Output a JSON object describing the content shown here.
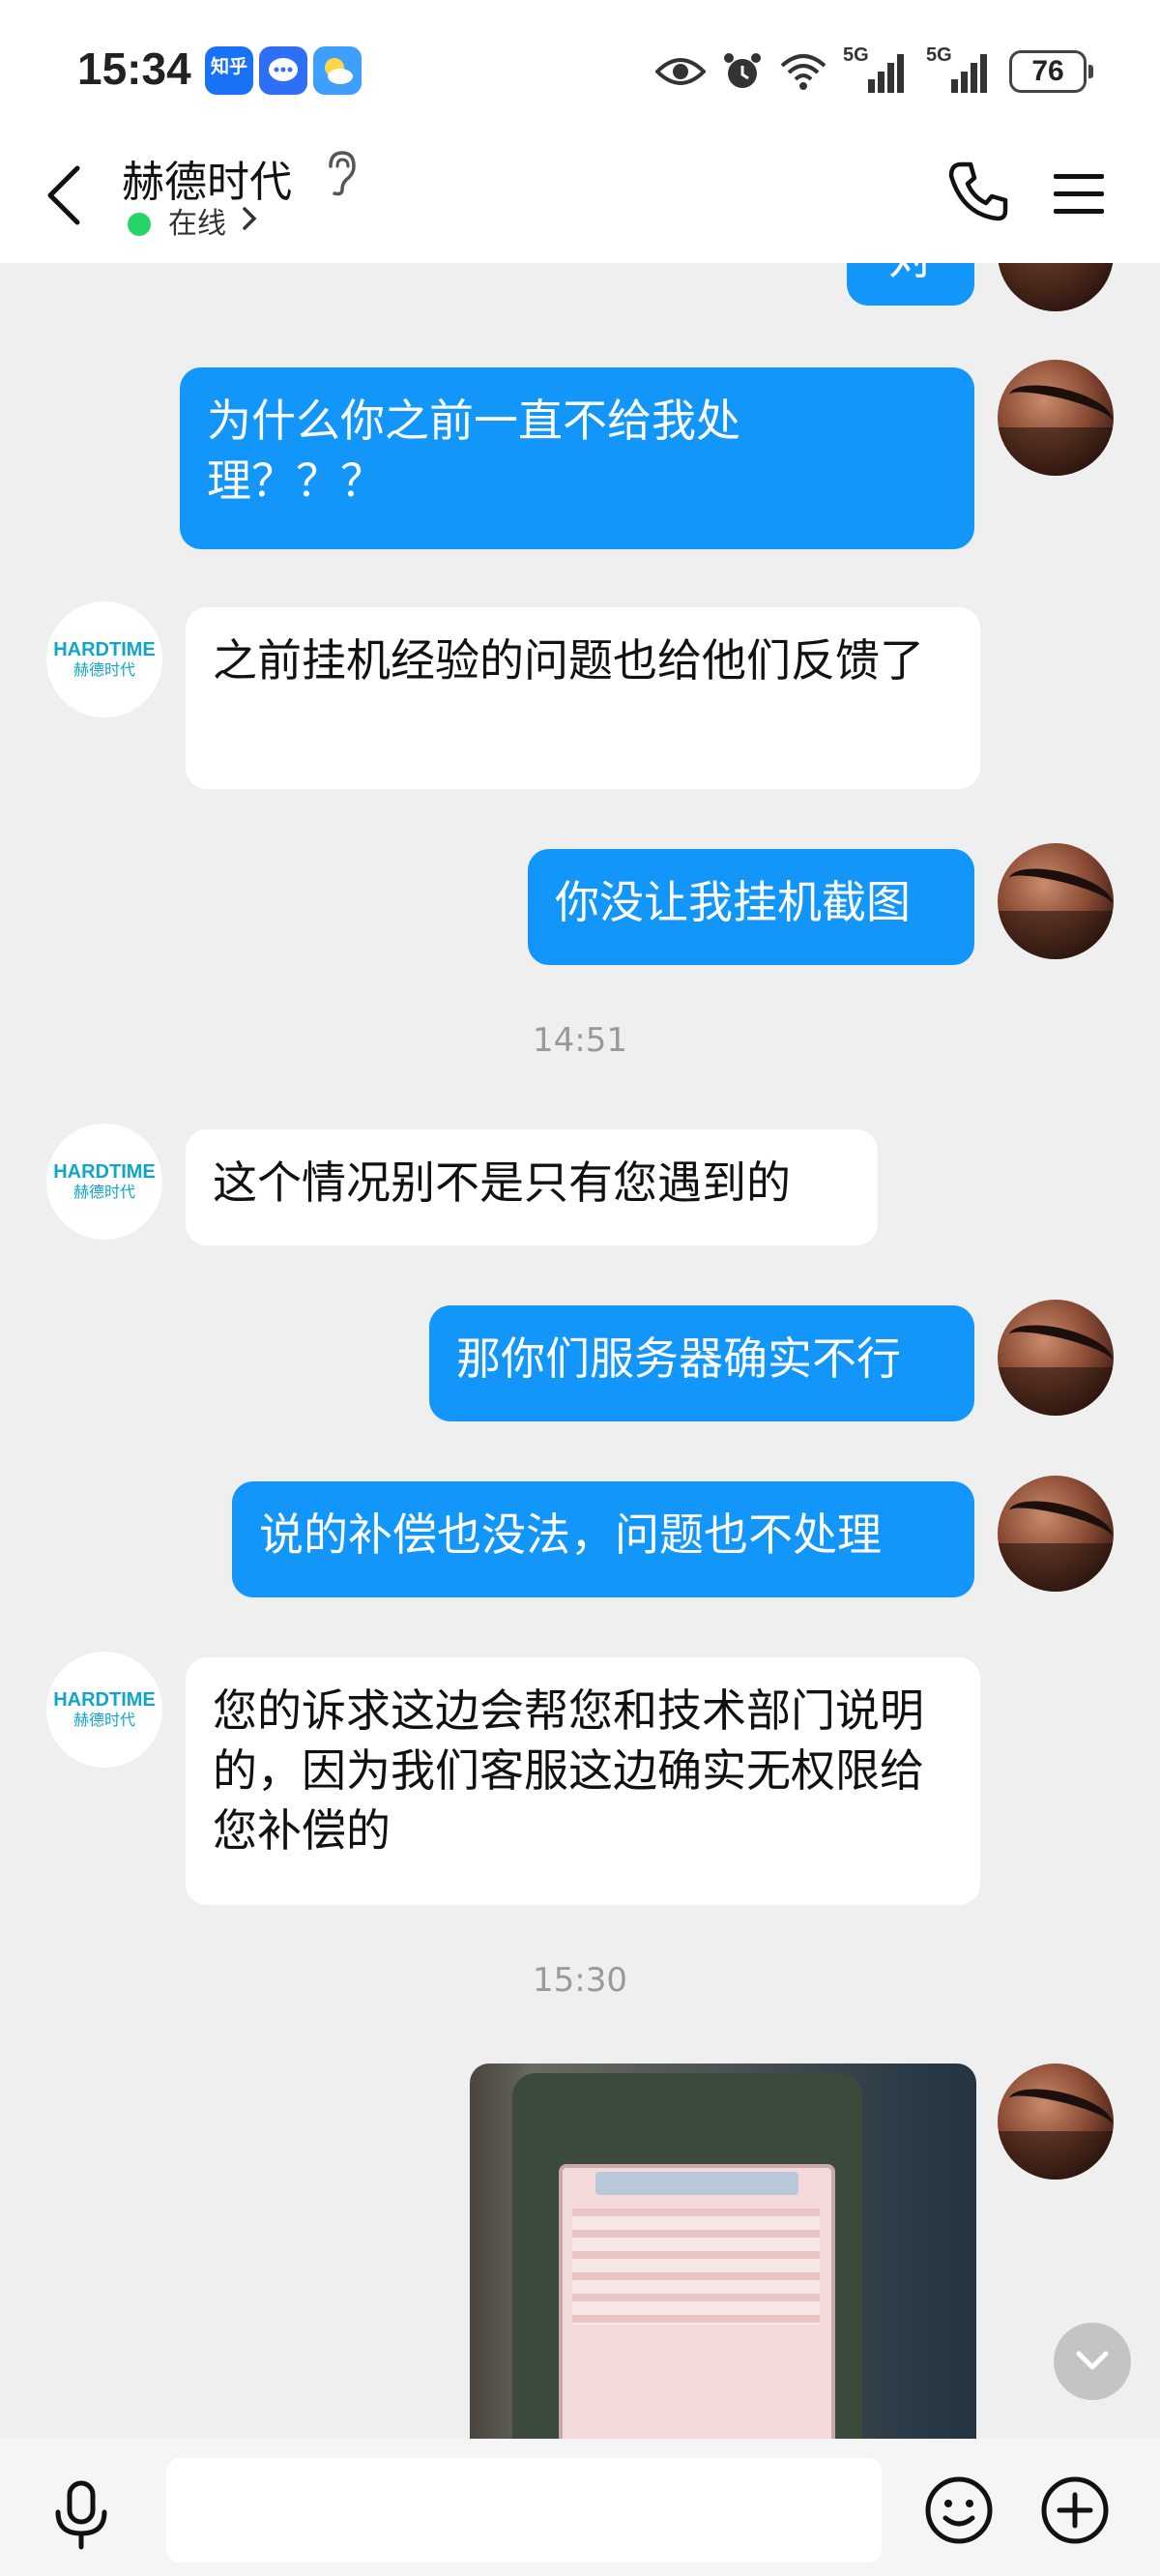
{
  "status_bar": {
    "time": "15:34",
    "zhihu_badge": "知乎",
    "signal_1_label": "5G",
    "signal_2_label": "5G",
    "battery": "76"
  },
  "header": {
    "contact_name": "赫德时代",
    "online_status": "在线"
  },
  "bot_logo": {
    "brand": "HARDTIME",
    "sub": "赫德时代"
  },
  "messages": [
    {
      "side": "out",
      "text": "对"
    },
    {
      "side": "out",
      "text": "为什么你之前一直不给我处理？？？"
    },
    {
      "side": "in",
      "text": "之前挂机经验的问题也给他们反馈了"
    },
    {
      "side": "out",
      "text": "你没让我挂机截图"
    },
    {
      "side": "in",
      "text": "这个情况别不是只有您遇到的"
    },
    {
      "side": "out",
      "text": "那你们服务器确实不行"
    },
    {
      "side": "out",
      "text": "说的补偿也没法，问题也不处理"
    },
    {
      "side": "in",
      "text": "您的诉求这边会帮您和技术部门说明的，因为我们客服这边确实无权限给您补偿的"
    }
  ],
  "time_separators": [
    "14:51",
    "15:30"
  ],
  "input": {
    "value": "",
    "placeholder": ""
  },
  "colors": {
    "outgoing_bubble": "#1296fa",
    "incoming_bubble": "#ffffff",
    "background": "#efefef",
    "online": "#25d366"
  }
}
